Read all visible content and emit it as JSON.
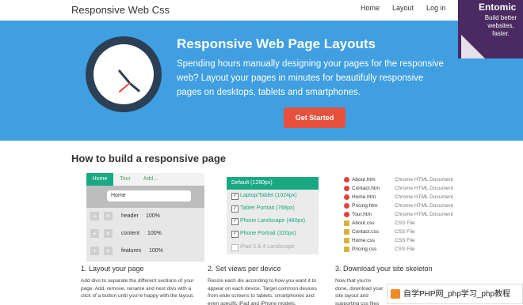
{
  "header": {
    "brand": "Responsive Web Css",
    "nav": [
      "Home",
      "Layout",
      "Log in"
    ]
  },
  "ribbon": {
    "logo": "Entomic",
    "tagline": "Build better websites, faster."
  },
  "hero": {
    "title": "Responsive Web Page Layouts",
    "text": "Spending hours manually designing your pages for the responsive web? Layout your pages in minutes for beautifully responsive pages on desktops, tablets and smartphones.",
    "cta": "Get Started"
  },
  "section_title": "How to build a responsive page",
  "editor": {
    "tabs": [
      "Home",
      "Tour",
      "Add..."
    ],
    "name_value": "Home",
    "rows": [
      {
        "label": "header",
        "pct": "100%"
      },
      {
        "label": "content",
        "pct": "100%"
      },
      {
        "label": "features",
        "pct": "100%"
      }
    ]
  },
  "devices": {
    "default": "Default (1280px)",
    "items": [
      {
        "label": "Laptop/Tablet (1024px)",
        "checked": true
      },
      {
        "label": "Tablet Portrait (768px)",
        "checked": true
      },
      {
        "label": "Phone Landscape (480px)",
        "checked": true
      },
      {
        "label": "Phone Portrait (320px)",
        "checked": true
      },
      {
        "label": "iPad 3 & 4 Landscape",
        "checked": false
      }
    ]
  },
  "files": [
    {
      "name": "About.htm",
      "type": "Chrome HTML Document"
    },
    {
      "name": "Contact.htm",
      "type": "Chrome HTML Document"
    },
    {
      "name": "Home.htm",
      "type": "Chrome HTML Document"
    },
    {
      "name": "Pricing.htm",
      "type": "Chrome HTML Document"
    },
    {
      "name": "Tour.htm",
      "type": "Chrome HTML Document"
    },
    {
      "name": "About.css",
      "type": "CSS File"
    },
    {
      "name": "Contact.css",
      "type": "CSS File"
    },
    {
      "name": "Home.css",
      "type": "CSS File"
    },
    {
      "name": "Pricing.css",
      "type": "CSS File"
    }
  ],
  "steps": [
    {
      "title": "1. Layout your page",
      "text": "Add divs to separate the different sections of your page. Add, remove, rename and nest divs with a click of a button until you're happy with the layout."
    },
    {
      "title": "2. Set views per device",
      "text": "Resize each div according to how you want it to appear on each device. Target common devices from wide screens to tablets, smartphones and even specific iPad and iPhone models."
    },
    {
      "title": "3. Download your site skeleton",
      "text": "Now that you're done, download your site layout and supporting css files then arrange your pages and you're good to go. Enjoy the extra time you've saved."
    }
  ],
  "watermark": "自学PHP网_php学习_php教程"
}
